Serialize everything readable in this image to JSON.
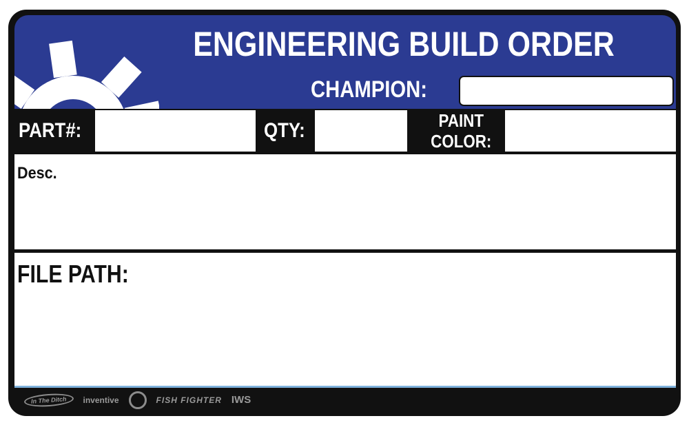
{
  "header": {
    "title": "ENGINEERING BUILD ORDER",
    "champion_label": "CHAMPION:",
    "champion_value": ""
  },
  "fields": {
    "part_label": "PART#:",
    "part_value": "",
    "qty_label": "QTY:",
    "qty_value": "",
    "paint_label_line1": "PAINT",
    "paint_label_line2": "COLOR:",
    "paint_value": ""
  },
  "desc": {
    "label": "Desc.",
    "value": ""
  },
  "file_path": {
    "label": "FILE PATH:",
    "value": ""
  },
  "footer": {
    "logos": [
      "In The Ditch",
      "inventive",
      "seal",
      "FISH FIGHTER",
      "IWS"
    ]
  },
  "colors": {
    "header_blue": "#2b3b92",
    "frame": "#111111",
    "accent_line": "#7fb2dc",
    "logo_gray": "#9a9a9a"
  }
}
